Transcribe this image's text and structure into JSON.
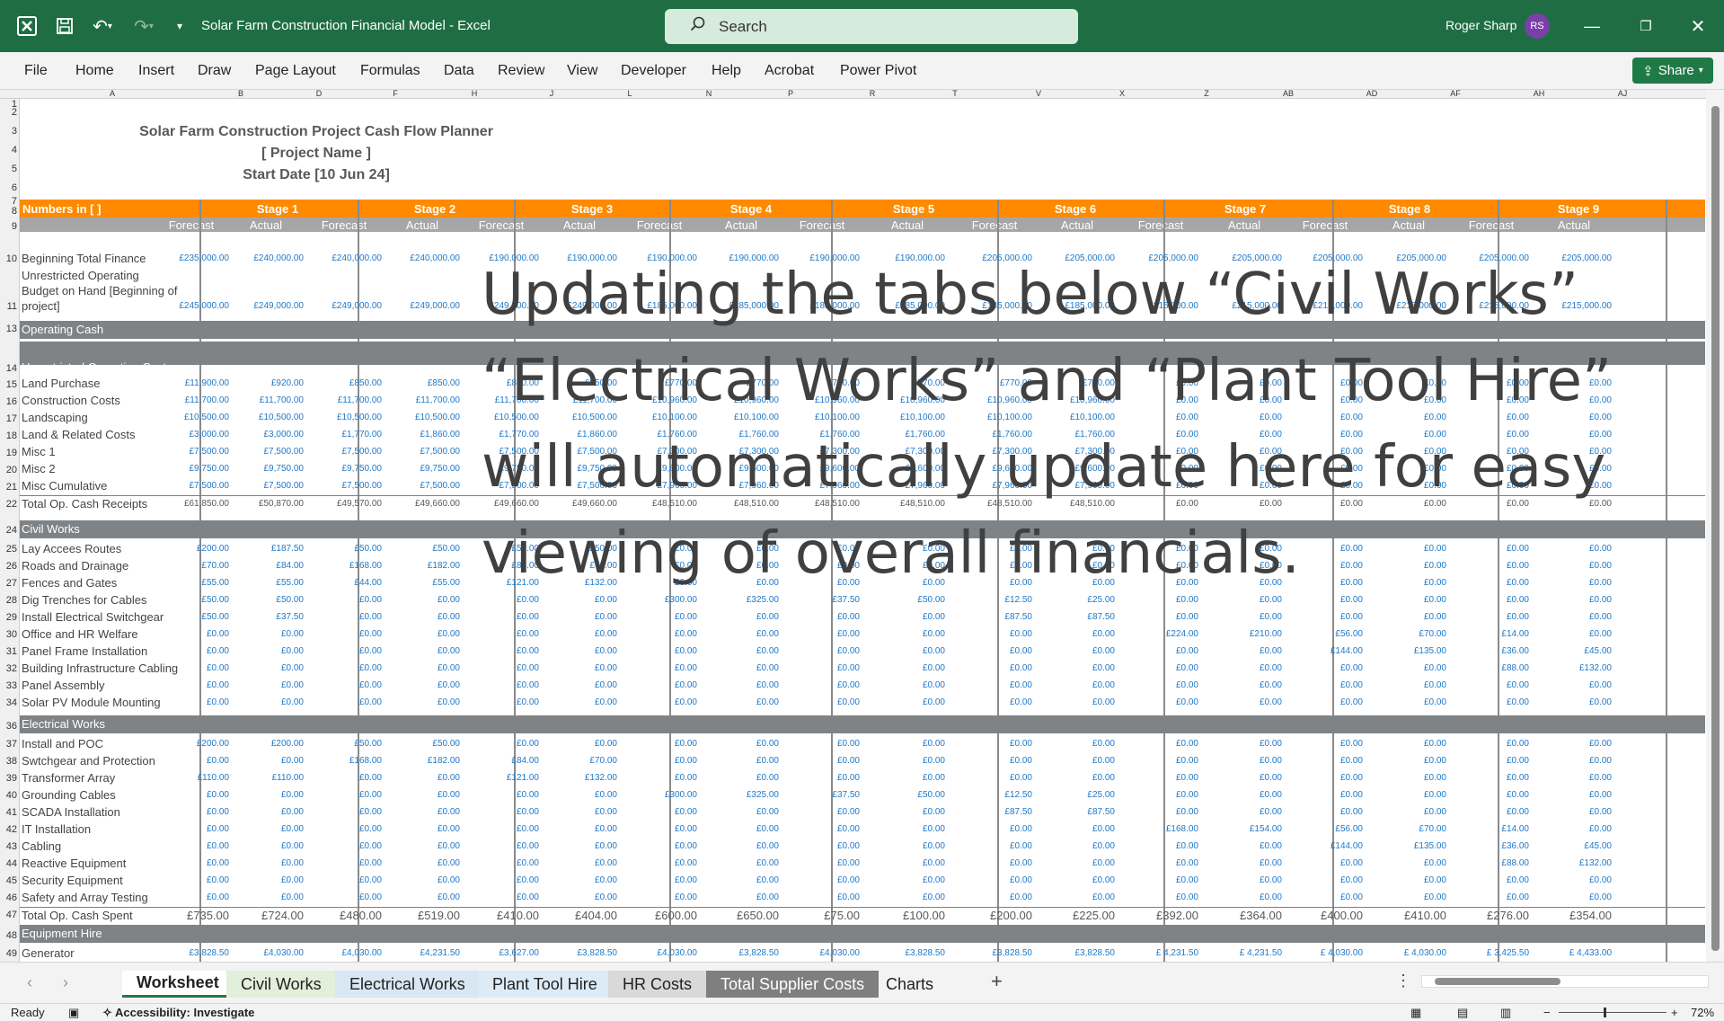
{
  "titlebar": {
    "doc_title": "Solar Farm Construction Financial Model  -  Excel",
    "search_placeholder": "Search",
    "user_name": "Roger Sharp",
    "user_initials": "RS"
  },
  "ribbon_tabs": [
    "File",
    "Home",
    "Insert",
    "Draw",
    "Page Layout",
    "Formulas",
    "Data",
    "Review",
    "View",
    "Developer",
    "Help",
    "Acrobat",
    "Power Pivot"
  ],
  "share_label": "Share",
  "column_headers": [
    "A",
    "B",
    "D",
    "F",
    "H",
    "J",
    "L",
    "N",
    "P",
    "R",
    "T",
    "V",
    "X",
    "Z",
    "AB",
    "AD",
    "AF",
    "AH",
    "AJ"
  ],
  "sheet": {
    "title": "Solar Farm Construction Project Cash Flow Planner",
    "project_name": "[ Project Name ]",
    "start_date": "Start Date [10 Jun 24]",
    "numbers_label": "Numbers in [ ]",
    "stages": [
      "Stage 1",
      "Stage 2",
      "Stage 3",
      "Stage 4",
      "Stage 5",
      "Stage 6",
      "Stage 7",
      "Stage 8",
      "Stage 9"
    ],
    "forecast_label": "Forecast",
    "actual_label": "Actual",
    "row10_label": "Beginning Total Finance",
    "row10": [
      "£235,000.00",
      "£240,000.00",
      "£240,000.00",
      "£240,000.00",
      "£190,000.00",
      "£190,000.00",
      "£190,000.00",
      "£190,000.00",
      "£190,000.00",
      "£190,000.00",
      "£205,000.00",
      "£205,000.00",
      "£205,000.00",
      "£205,000.00",
      "£205,000.00",
      "£205,000.00",
      "£205,000.00",
      "£205,000.00"
    ],
    "row11_label_1": "Unrestricted Operating",
    "row11_label_2": "Budget on Hand [Beginning of",
    "row11_label_3": "project]",
    "row11": [
      "£245,000.00",
      "£249,000.00",
      "£249,000.00",
      "£249,000.00",
      "£249,000.00",
      "£249,000.00",
      "£185,000.00",
      "£185,000.00",
      "£185,000.00",
      "£185,000.00",
      "£185,000.00",
      "£185,000.00",
      "£215,000.00",
      "£215,000.00",
      "£215,000.00",
      "£215,000.00",
      "£215,000.00",
      "£215,000.00"
    ],
    "operating_cash": "Operating Cash",
    "unrestricted_costs": "Unrestricted Operating Costs",
    "op_rows": [
      {
        "n": "15",
        "label": "Land Purchase",
        "v": [
          "£11,900.00",
          "£920.00",
          "£850.00",
          "£850.00",
          "£850.00",
          "£850.00",
          "£770.00",
          "£770.00",
          "£770.00",
          "£770.00",
          "£770.00",
          "£770.00",
          "£0.00",
          "£0.00",
          "£0.00",
          "£0.00",
          "£0.00",
          "£0.00"
        ]
      },
      {
        "n": "16",
        "label": "Construction Costs",
        "v": [
          "£11,700.00",
          "£11,700.00",
          "£11,700.00",
          "£11,700.00",
          "£11,700.00",
          "£11,700.00",
          "£10,960.00",
          "£10,960.00",
          "£10,960.00",
          "£10,960.00",
          "£10,960.00",
          "£10,960.00",
          "£0.00",
          "£0.00",
          "£0.00",
          "£0.00",
          "£0.00",
          "£0.00"
        ]
      },
      {
        "n": "17",
        "label": "Landscaping",
        "v": [
          "£10,500.00",
          "£10,500.00",
          "£10,500.00",
          "£10,500.00",
          "£10,500.00",
          "£10,500.00",
          "£10,100.00",
          "£10,100.00",
          "£10,100.00",
          "£10,100.00",
          "£10,100.00",
          "£10,100.00",
          "£0.00",
          "£0.00",
          "£0.00",
          "£0.00",
          "£0.00",
          "£0.00"
        ]
      },
      {
        "n": "18",
        "label": "Land & Related Costs",
        "v": [
          "£3,000.00",
          "£3,000.00",
          "£1,770.00",
          "£1,860.00",
          "£1,770.00",
          "£1,860.00",
          "£1,760.00",
          "£1,760.00",
          "£1,760.00",
          "£1,760.00",
          "£1,760.00",
          "£1,760.00",
          "£0.00",
          "£0.00",
          "£0.00",
          "£0.00",
          "£0.00",
          "£0.00"
        ]
      },
      {
        "n": "19",
        "label": "Misc 1",
        "v": [
          "£7,500.00",
          "£7,500.00",
          "£7,500.00",
          "£7,500.00",
          "£7,500.00",
          "£7,500.00",
          "£7,300.00",
          "£7,300.00",
          "£7,300.00",
          "£7,300.00",
          "£7,300.00",
          "£7,300.00",
          "£0.00",
          "£0.00",
          "£0.00",
          "£0.00",
          "£0.00",
          "£0.00"
        ]
      },
      {
        "n": "20",
        "label": "Misc 2",
        "v": [
          "£9,750.00",
          "£9,750.00",
          "£9,750.00",
          "£9,750.00",
          "£9,750.00",
          "£9,750.00",
          "£9,600.00",
          "£9,600.00",
          "£9,600.00",
          "£9,600.00",
          "£9,600.00",
          "£9,600.00",
          "£0.00",
          "£0.00",
          "£0.00",
          "£0.00",
          "£0.00",
          "£0.00"
        ]
      },
      {
        "n": "21",
        "label": "Misc Cumulative",
        "v": [
          "£7,500.00",
          "£7,500.00",
          "£7,500.00",
          "£7,500.00",
          "£7,500.00",
          "£7,500.00",
          "£7,960.00",
          "£7,960.00",
          "£7,960.00",
          "£7,960.00",
          "£7,960.00",
          "£7,960.00",
          "£0.00",
          "£0.00",
          "£0.00",
          "£0.00",
          "£0.00",
          "£0.00"
        ]
      }
    ],
    "total_receipts": {
      "n": "22",
      "label": "Total Op. Cash Receipts",
      "v": [
        "£61,850.00",
        "£50,870.00",
        "£49,570.00",
        "£49,660.00",
        "£49,660.00",
        "£49,660.00",
        "£48,510.00",
        "£48,510.00",
        "£48,510.00",
        "£48,510.00",
        "£48,510.00",
        "£48,510.00",
        "£0.00",
        "£0.00",
        "£0.00",
        "£0.00",
        "£0.00",
        "£0.00"
      ]
    },
    "civil_works": "Civil Works",
    "civil_rows": [
      {
        "n": "25",
        "label": "Lay Accees Routes",
        "v": [
          "£200.00",
          "£187.50",
          "£50.00",
          "£50.00",
          "£50.00",
          "£50.00",
          "£0.00",
          "£0.00",
          "£0.00",
          "£0.00",
          "£0.00",
          "£0.00",
          "£0.00",
          "£0.00",
          "£0.00",
          "£0.00",
          "£0.00",
          "£0.00"
        ]
      },
      {
        "n": "26",
        "label": "Roads and Drainage",
        "v": [
          "£70.00",
          "£84.00",
          "£168.00",
          "£182.00",
          "£84.00",
          "£70.00",
          "£0.00",
          "£0.00",
          "£0.00",
          "£0.00",
          "£0.00",
          "£0.00",
          "£0.00",
          "£0.00",
          "£0.00",
          "£0.00",
          "£0.00",
          "£0.00"
        ]
      },
      {
        "n": "27",
        "label": "Fences and Gates",
        "v": [
          "£55.00",
          "£55.00",
          "£44.00",
          "£55.00",
          "£121.00",
          "£132.00",
          "£0.00",
          "£0.00",
          "£0.00",
          "£0.00",
          "£0.00",
          "£0.00",
          "£0.00",
          "£0.00",
          "£0.00",
          "£0.00",
          "£0.00",
          "£0.00"
        ]
      },
      {
        "n": "28",
        "label": "Dig Trenches for Cables",
        "v": [
          "£50.00",
          "£50.00",
          "£0.00",
          "£0.00",
          "£0.00",
          "£0.00",
          "£300.00",
          "£325.00",
          "£37.50",
          "£50.00",
          "£12.50",
          "£25.00",
          "£0.00",
          "£0.00",
          "£0.00",
          "£0.00",
          "£0.00",
          "£0.00"
        ]
      },
      {
        "n": "29",
        "label": "Install Electrical Switchgear",
        "v": [
          "£50.00",
          "£37.50",
          "£0.00",
          "£0.00",
          "£0.00",
          "£0.00",
          "£0.00",
          "£0.00",
          "£0.00",
          "£0.00",
          "£87.50",
          "£87.50",
          "£0.00",
          "£0.00",
          "£0.00",
          "£0.00",
          "£0.00",
          "£0.00"
        ]
      },
      {
        "n": "30",
        "label": "Office and HR Welfare",
        "v": [
          "£0.00",
          "£0.00",
          "£0.00",
          "£0.00",
          "£0.00",
          "£0.00",
          "£0.00",
          "£0.00",
          "£0.00",
          "£0.00",
          "£0.00",
          "£0.00",
          "£224.00",
          "£210.00",
          "£56.00",
          "£70.00",
          "£14.00",
          "£0.00"
        ]
      },
      {
        "n": "31",
        "label": "Panel Frame Installation",
        "v": [
          "£0.00",
          "£0.00",
          "£0.00",
          "£0.00",
          "£0.00",
          "£0.00",
          "£0.00",
          "£0.00",
          "£0.00",
          "£0.00",
          "£0.00",
          "£0.00",
          "£0.00",
          "£0.00",
          "£144.00",
          "£135.00",
          "£36.00",
          "£45.00"
        ]
      },
      {
        "n": "32",
        "label": "Building Infrastructure Cabling",
        "v": [
          "£0.00",
          "£0.00",
          "£0.00",
          "£0.00",
          "£0.00",
          "£0.00",
          "£0.00",
          "£0.00",
          "£0.00",
          "£0.00",
          "£0.00",
          "£0.00",
          "£0.00",
          "£0.00",
          "£0.00",
          "£0.00",
          "£88.00",
          "£132.00"
        ]
      },
      {
        "n": "33",
        "label": "Panel Assembly",
        "v": [
          "£0.00",
          "£0.00",
          "£0.00",
          "£0.00",
          "£0.00",
          "£0.00",
          "£0.00",
          "£0.00",
          "£0.00",
          "£0.00",
          "£0.00",
          "£0.00",
          "£0.00",
          "£0.00",
          "£0.00",
          "£0.00",
          "£0.00",
          "£0.00"
        ]
      },
      {
        "n": "34",
        "label": "Solar PV Module Mounting",
        "v": [
          "£0.00",
          "£0.00",
          "£0.00",
          "£0.00",
          "£0.00",
          "£0.00",
          "£0.00",
          "£0.00",
          "£0.00",
          "£0.00",
          "£0.00",
          "£0.00",
          "£0.00",
          "£0.00",
          "£0.00",
          "£0.00",
          "£0.00",
          "£0.00"
        ]
      }
    ],
    "electrical_works": "Electrical Works",
    "elec_rows": [
      {
        "n": "37",
        "label": "Install and POC",
        "v": [
          "£200.00",
          "£200.00",
          "£50.00",
          "£50.00",
          "£0.00",
          "£0.00",
          "£0.00",
          "£0.00",
          "£0.00",
          "£0.00",
          "£0.00",
          "£0.00",
          "£0.00",
          "£0.00",
          "£0.00",
          "£0.00",
          "£0.00",
          "£0.00"
        ]
      },
      {
        "n": "38",
        "label": "Swtchgear and Protection",
        "v": [
          "£0.00",
          "£0.00",
          "£168.00",
          "£182.00",
          "£84.00",
          "£70.00",
          "£0.00",
          "£0.00",
          "£0.00",
          "£0.00",
          "£0.00",
          "£0.00",
          "£0.00",
          "£0.00",
          "£0.00",
          "£0.00",
          "£0.00",
          "£0.00"
        ]
      },
      {
        "n": "39",
        "label": "Transformer Array",
        "v": [
          "£110.00",
          "£110.00",
          "£0.00",
          "£0.00",
          "£121.00",
          "£132.00",
          "£0.00",
          "£0.00",
          "£0.00",
          "£0.00",
          "£0.00",
          "£0.00",
          "£0.00",
          "£0.00",
          "£0.00",
          "£0.00",
          "£0.00",
          "£0.00"
        ]
      },
      {
        "n": "40",
        "label": "Grounding Cables",
        "v": [
          "£0.00",
          "£0.00",
          "£0.00",
          "£0.00",
          "£0.00",
          "£0.00",
          "£300.00",
          "£325.00",
          "£37.50",
          "£50.00",
          "£12.50",
          "£25.00",
          "£0.00",
          "£0.00",
          "£0.00",
          "£0.00",
          "£0.00",
          "£0.00"
        ]
      },
      {
        "n": "41",
        "label": "SCADA Installation",
        "v": [
          "£0.00",
          "£0.00",
          "£0.00",
          "£0.00",
          "£0.00",
          "£0.00",
          "£0.00",
          "£0.00",
          "£0.00",
          "£0.00",
          "£87.50",
          "£87.50",
          "£0.00",
          "£0.00",
          "£0.00",
          "£0.00",
          "£0.00",
          "£0.00"
        ]
      },
      {
        "n": "42",
        "label": "IT Installation",
        "v": [
          "£0.00",
          "£0.00",
          "£0.00",
          "£0.00",
          "£0.00",
          "£0.00",
          "£0.00",
          "£0.00",
          "£0.00",
          "£0.00",
          "£0.00",
          "£0.00",
          "£168.00",
          "£154.00",
          "£56.00",
          "£70.00",
          "£14.00",
          "£0.00"
        ]
      },
      {
        "n": "43",
        "label": "Cabling",
        "v": [
          "£0.00",
          "£0.00",
          "£0.00",
          "£0.00",
          "£0.00",
          "£0.00",
          "£0.00",
          "£0.00",
          "£0.00",
          "£0.00",
          "£0.00",
          "£0.00",
          "£0.00",
          "£0.00",
          "£144.00",
          "£135.00",
          "£36.00",
          "£45.00"
        ]
      },
      {
        "n": "44",
        "label": "Reactive Equipment",
        "v": [
          "£0.00",
          "£0.00",
          "£0.00",
          "£0.00",
          "£0.00",
          "£0.00",
          "£0.00",
          "£0.00",
          "£0.00",
          "£0.00",
          "£0.00",
          "£0.00",
          "£0.00",
          "£0.00",
          "£0.00",
          "£0.00",
          "£88.00",
          "£132.00"
        ]
      },
      {
        "n": "45",
        "label": "Security Equipment",
        "v": [
          "£0.00",
          "£0.00",
          "£0.00",
          "£0.00",
          "£0.00",
          "£0.00",
          "£0.00",
          "£0.00",
          "£0.00",
          "£0.00",
          "£0.00",
          "£0.00",
          "£0.00",
          "£0.00",
          "£0.00",
          "£0.00",
          "£0.00",
          "£0.00"
        ]
      },
      {
        "n": "46",
        "label": "Safety and Array Testing",
        "v": [
          "£0.00",
          "£0.00",
          "£0.00",
          "£0.00",
          "£0.00",
          "£0.00",
          "£0.00",
          "£0.00",
          "£0.00",
          "£0.00",
          "£0.00",
          "£0.00",
          "£0.00",
          "£0.00",
          "£0.00",
          "£0.00",
          "£0.00",
          "£0.00"
        ]
      }
    ],
    "total_spent": {
      "n": "47",
      "label": "Total Op. Cash Spent",
      "v": [
        "£735.00",
        "£724.00",
        "£480.00",
        "£519.00",
        "£410.00",
        "£404.00",
        "£600.00",
        "£650.00",
        "£75.00",
        "£100.00",
        "£200.00",
        "£225.00",
        "£392.00",
        "£364.00",
        "£400.00",
        "£410.00",
        "£276.00",
        "£354.00"
      ]
    },
    "equipment_hire": "Equipment Hire",
    "generator": {
      "n": "49",
      "label": "Generator",
      "v": [
        "£3,828.50",
        "£4,030.00",
        "£4,030.00",
        "£4,231.50",
        "£3,627.00",
        "£3,828.50",
        "£4,030.00",
        "£3,828.50",
        "£4,030.00",
        "£3,828.50",
        "£3,828.50",
        "£3,828.50",
        "£   4,231.50",
        "£   4,231.50",
        "£   4,030.00",
        "£   4,030.00",
        "£   3,425.50",
        "£   4,433.00"
      ]
    }
  },
  "overlay_lines": [
    "Updating the tabs below “Civil Works”",
    "“Electrical Works” and “Plant Tool Hire”",
    "will automatically update here for easy",
    "viewing of overall financials."
  ],
  "sheet_tabs": [
    "Worksheet",
    "Civil Works",
    "Electrical Works",
    "Plant Tool Hire",
    "HR Costs",
    "Total Supplier Costs",
    "Charts"
  ],
  "status": {
    "ready": "Ready",
    "accessibility": "Accessibility: Investigate",
    "zoom": "72%"
  }
}
